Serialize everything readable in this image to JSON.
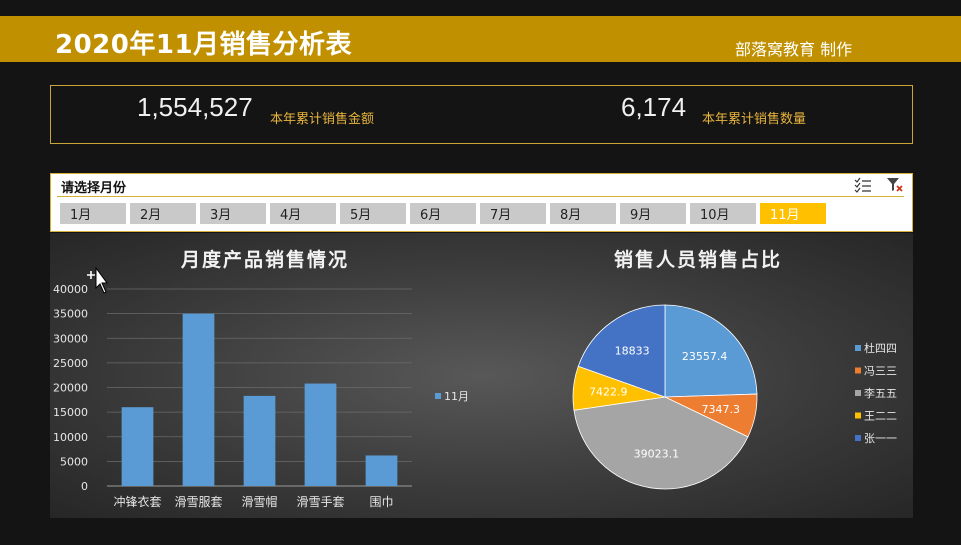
{
  "header": {
    "title": "2020年11月销售分析表",
    "credit": "部落窝教育 制作"
  },
  "kpis": [
    {
      "value": "1,554,527",
      "label": "本年累计销售金额"
    },
    {
      "value": "6,174",
      "label": "本年累计销售数量"
    }
  ],
  "slicer": {
    "title": "请选择月份",
    "icons": [
      "multi-select-icon",
      "clear-filter-icon"
    ],
    "months": [
      "1月",
      "2月",
      "3月",
      "4月",
      "5月",
      "6月",
      "7月",
      "8月",
      "9月",
      "10月",
      "11月"
    ],
    "selected": "11月",
    "selected_color": "#ffc000"
  },
  "chart_data": [
    {
      "type": "bar",
      "title": "月度产品销售情况",
      "categories": [
        "冲锋衣套",
        "滑雪服套",
        "滑雪帽",
        "滑雪手套",
        "围巾"
      ],
      "series": [
        {
          "name": "11月",
          "values": [
            16000,
            35000,
            18300,
            20800,
            6200
          ]
        }
      ],
      "yticks": [
        0,
        5000,
        10000,
        15000,
        20000,
        25000,
        30000,
        35000,
        40000
      ],
      "ylim": [
        0,
        40000
      ],
      "grid": true,
      "legend": "right",
      "color": "#5b9bd5"
    },
    {
      "type": "pie",
      "title": "销售人员销售占比",
      "labels": [
        "杜四四",
        "冯三三",
        "李五五",
        "王二二",
        "张一一"
      ],
      "values": [
        23557.4,
        7347.3,
        39023.1,
        7422.9,
        18833
      ],
      "colors": [
        "#5b9bd5",
        "#ed7d31",
        "#a5a5a5",
        "#ffc000",
        "#4472c4"
      ],
      "legend": "right"
    }
  ]
}
